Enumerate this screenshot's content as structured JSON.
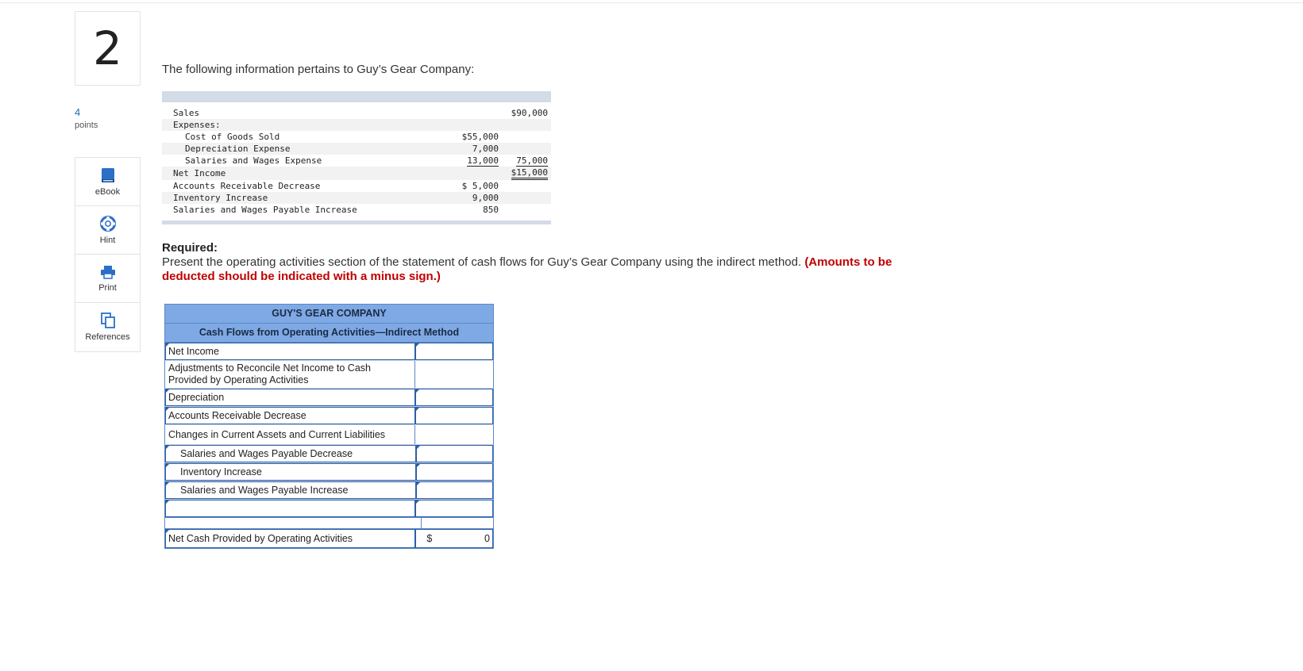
{
  "question": {
    "number": "2",
    "points_value": "4",
    "points_label": "points"
  },
  "tools": [
    {
      "label": "eBook",
      "icon": "book-icon"
    },
    {
      "label": "Hint",
      "icon": "lifebuoy-icon"
    },
    {
      "label": "Print",
      "icon": "printer-icon"
    },
    {
      "label": "References",
      "icon": "copy-icon"
    }
  ],
  "intro": "The following information pertains to Guy’s Gear Company:",
  "info": {
    "rows": [
      {
        "label": "Sales",
        "v1": "",
        "v2": "$90,000",
        "indent": false
      },
      {
        "label": "Expenses:",
        "v1": "",
        "v2": "",
        "indent": false
      },
      {
        "label": "Cost of Goods Sold",
        "v1": "$55,000",
        "v2": "",
        "indent": true
      },
      {
        "label": "Depreciation Expense",
        "v1": "7,000",
        "v2": "",
        "indent": true
      },
      {
        "label": "Salaries and Wages Expense",
        "v1": "13,000",
        "v2": "75,000",
        "indent": true
      },
      {
        "label": "Net Income",
        "v1": "",
        "v2": "$15,000",
        "indent": false
      },
      {
        "label": "Accounts Receivable Decrease",
        "v1": "$ 5,000",
        "v2": "",
        "indent": false
      },
      {
        "label": "Inventory Increase",
        "v1": "9,000",
        "v2": "",
        "indent": false
      },
      {
        "label": "Salaries and Wages Payable Increase",
        "v1": "850",
        "v2": "",
        "indent": false
      }
    ]
  },
  "required": {
    "heading": "Required:",
    "text": "Present the operating activities section of the statement of cash flows for Guy’s Gear Company using the indirect method.",
    "note": "(Amounts to be deducted should be indicated with a minus sign.)"
  },
  "worksheet": {
    "company": "GUY'S GEAR COMPANY",
    "title": "Cash Flows from Operating Activities—Indirect Method",
    "rows": {
      "net_income": "Net Income",
      "adjustments": "Adjustments to Reconcile Net Income to Cash Provided by Operating Activities",
      "depreciation": "Depreciation",
      "ar_decrease": "Accounts Receivable Decrease",
      "changes": "Changes in Current Assets and Current Liabilities",
      "swp_decrease": "Salaries and Wages Payable Decrease",
      "inventory_increase": "Inventory Increase",
      "swp_increase": "Salaries and Wages Payable Increase",
      "blank": ""
    },
    "total_label": "Net Cash Provided by Operating Activities",
    "total_currency": "$",
    "total_value": "0"
  }
}
